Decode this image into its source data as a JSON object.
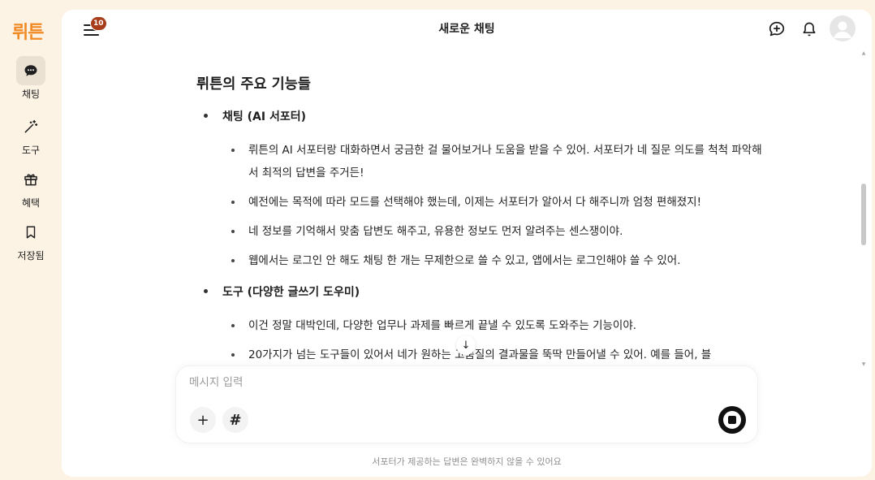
{
  "brand": {
    "logo_text": "뤼튼",
    "accent": "#f08a24"
  },
  "sidebar": {
    "items": [
      {
        "label": "채팅",
        "icon": "chat-bubble-icon",
        "active": true
      },
      {
        "label": "도구",
        "icon": "magic-wand-icon",
        "active": false
      },
      {
        "label": "혜택",
        "icon": "gift-icon",
        "active": false
      },
      {
        "label": "저장됨",
        "icon": "bookmark-icon",
        "active": false
      }
    ]
  },
  "header": {
    "title": "새로운 채팅",
    "menu_badge": "10",
    "icons": [
      "new-chat-icon",
      "bell-icon",
      "avatar"
    ]
  },
  "content": {
    "heading": "뤼튼의 주요 기능들",
    "sections": [
      {
        "title": "채팅 (AI 서포터)",
        "bullets": [
          "뤼튼의 AI 서포터랑 대화하면서 궁금한 걸 물어보거나 도움을 받을 수 있어. 서포터가 네 질문 의도를 척척 파악해서 최적의 답변을 주거든!",
          "예전에는 목적에 따라 모드를 선택해야 했는데, 이제는 서포터가 알아서 다 해주니까 엄청 편해졌지!",
          "네 정보를 기억해서 맞춤 답변도 해주고, 유용한 정보도 먼저 알려주는 센스쟁이야.",
          "웹에서는 로그인 안 해도 채팅 한 개는 무제한으로 쓸 수 있고, 앱에서는 로그인해야 쓸 수 있어."
        ]
      },
      {
        "title": "도구 (다양한 글쓰기 도우미)",
        "bullets": [
          "이건 정말 대박인데, 다양한 업무나 과제를 빠르게 끝낼 수 있도록 도와주는 기능이야.",
          "20가지가 넘는 도구들이 있어서 네가 원하는 고품질의 결과물을 뚝딱 만들어낼 수 있어. 예를 들어, 블"
        ]
      }
    ]
  },
  "composer": {
    "placeholder": "메시지 입력",
    "add_label": "+",
    "hashtag_label": "#"
  },
  "scroll_down_label": "↓",
  "disclaimer": "서포터가 제공하는 답변은 완벽하지 않을 수 있어요"
}
